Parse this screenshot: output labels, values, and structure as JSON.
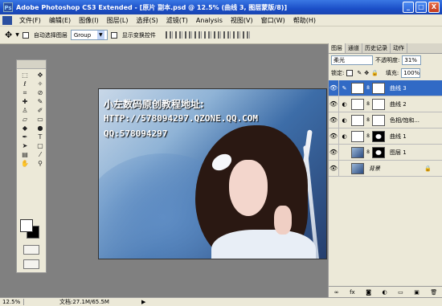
{
  "title": "Adobe Photoshop CS3 Extended - [原片 副本.psd @ 12.5% (曲线 3, 图层蒙版/8)]",
  "window_buttons": [
    "_",
    "□",
    "X"
  ],
  "menu": [
    "文件(F)",
    "编辑(E)",
    "图像(I)",
    "图层(L)",
    "选择(S)",
    "滤镜(T)",
    "Analysis",
    "视图(V)",
    "窗口(W)",
    "帮助(H)"
  ],
  "options": {
    "auto_select_label": "自动选择图层",
    "group_value": "Group",
    "show_transform_label": "显示变换控件"
  },
  "canvas_text": {
    "line1": "小左数码原创教程地址:",
    "line2": "HTTP://578094297.QZONE.QQ.COM",
    "line3": "QQ:578094297"
  },
  "panel": {
    "tabs": [
      "图层",
      "通道",
      "历史记录",
      "动作"
    ],
    "blend_mode": "柔光",
    "opacity_label": "不透明度:",
    "opacity_value": "31%",
    "lock_label": "锁定:",
    "fill_label": "填充:",
    "fill_value": "100%",
    "layers": [
      {
        "name": "曲线 3",
        "selected": true
      },
      {
        "name": "曲线 2",
        "selected": false
      },
      {
        "name": "色相/饱和...",
        "selected": false
      },
      {
        "name": "曲线 1",
        "selected": false
      },
      {
        "name": "图层 1",
        "selected": false
      },
      {
        "name": "背景",
        "selected": false
      }
    ]
  },
  "status": {
    "zoom": "12.5%",
    "doc": "文档:27.1M/65.5M"
  },
  "colors": {
    "titlebar": "#1b4fc8",
    "selection": "#316ac5"
  }
}
